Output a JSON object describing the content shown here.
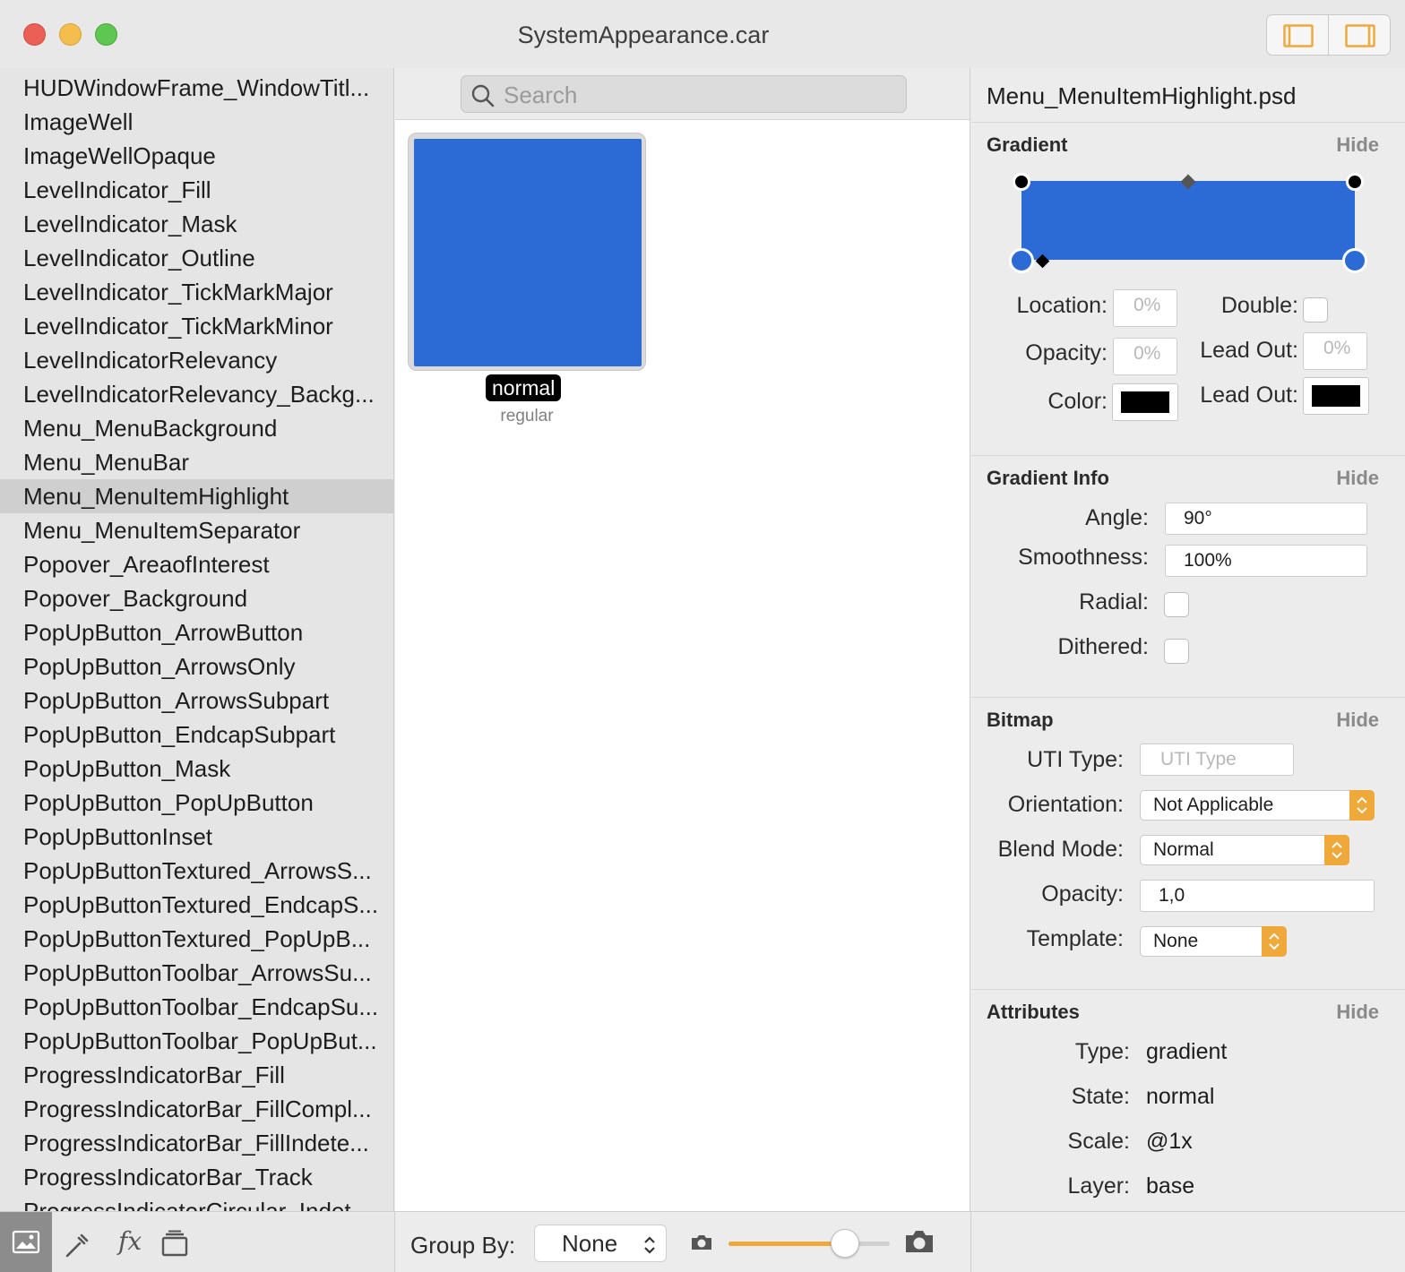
{
  "window": {
    "title": "SystemAppearance.car",
    "traffic_lights": [
      "close",
      "minimize",
      "zoom"
    ]
  },
  "sidebar": {
    "selected_index": 12,
    "items": [
      "HUDWindowFrame_WindowTitl...",
      "ImageWell",
      "ImageWellOpaque",
      "LevelIndicator_Fill",
      "LevelIndicator_Mask",
      "LevelIndicator_Outline",
      "LevelIndicator_TickMarkMajor",
      "LevelIndicator_TickMarkMinor",
      "LevelIndicatorRelevancy",
      "LevelIndicatorRelevancy_Backg...",
      "Menu_MenuBackground",
      "Menu_MenuBar",
      "Menu_MenuItemHighlight",
      "Menu_MenuItemSeparator",
      "Popover_AreaofInterest",
      "Popover_Background",
      "PopUpButton_ArrowButton",
      "PopUpButton_ArrowsOnly",
      "PopUpButton_ArrowsSubpart",
      "PopUpButton_EndcapSubpart",
      "PopUpButton_Mask",
      "PopUpButton_PopUpButton",
      "PopUpButtonInset",
      "PopUpButtonTextured_ArrowsS...",
      "PopUpButtonTextured_EndcapS...",
      "PopUpButtonTextured_PopUpB...",
      "PopUpButtonToolbar_ArrowsSu...",
      "PopUpButtonToolbar_EndcapSu...",
      "PopUpButtonToolbar_PopUpBut...",
      "ProgressIndicatorBar_Fill",
      "ProgressIndicatorBar_FillCompl...",
      "ProgressIndicatorBar_FillIndete...",
      "ProgressIndicatorBar_Track",
      "ProgressIndicatorCircular_Indet..."
    ]
  },
  "center": {
    "search_placeholder": "Search",
    "asset": {
      "state_badge": "normal",
      "sublabel": "regular",
      "color": "#2c6bd6"
    }
  },
  "inspector": {
    "filename": "Menu_MenuItemHighlight.psd",
    "gradient": {
      "header": "Gradient",
      "hide": "Hide",
      "location_label": "Location:",
      "location_placeholder": "0%",
      "opacity_label": "Opacity:",
      "opacity_placeholder": "0%",
      "color_label": "Color:",
      "double_label": "Double:",
      "lead_out_label": "Lead Out:",
      "lead_out_placeholder": "0%",
      "lead_out_color_label": "Lead Out:",
      "swatch_color": "#000000",
      "gradient_color": "#2c6bd6"
    },
    "gradient_info": {
      "header": "Gradient Info",
      "hide": "Hide",
      "angle_label": "Angle:",
      "angle_value": "90°",
      "smoothness_label": "Smoothness:",
      "smoothness_value": "100%",
      "radial_label": "Radial:",
      "dithered_label": "Dithered:"
    },
    "bitmap": {
      "header": "Bitmap",
      "hide": "Hide",
      "uti_label": "UTI Type:",
      "uti_placeholder": "UTI Type",
      "orientation_label": "Orientation:",
      "orientation_value": "Not Applicable",
      "blend_label": "Blend Mode:",
      "blend_value": "Normal",
      "opacity_label": "Opacity:",
      "opacity_value": "1,0",
      "template_label": "Template:",
      "template_value": "None"
    },
    "attributes": {
      "header": "Attributes",
      "hide": "Hide",
      "type_label": "Type:",
      "type_value": "gradient",
      "state_label": "State:",
      "state_value": "normal",
      "scale_label": "Scale:",
      "scale_value": "@1x",
      "layer_label": "Layer:",
      "layer_value": "base"
    }
  },
  "bottom": {
    "tools": [
      "image-icon",
      "eyedropper-icon",
      "fx-icon",
      "stack-icon"
    ],
    "fx_glyph": "fx",
    "group_by_label": "Group By:",
    "group_by_value": "None",
    "zoom_slider_fraction": 0.72,
    "accent": "#efa83a"
  }
}
